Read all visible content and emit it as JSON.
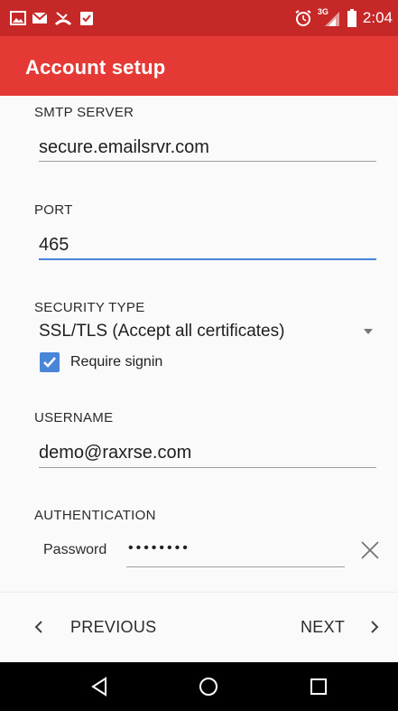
{
  "status_bar": {
    "time": "2:04",
    "network": "3G",
    "icons": [
      "image-icon",
      "mail-icon",
      "missed-call-icon",
      "clipboard-check-icon",
      "alarm-icon",
      "signal-icon",
      "battery-icon"
    ]
  },
  "app_bar": {
    "title": "Account setup"
  },
  "form": {
    "smtp_server": {
      "label": "SMTP SERVER",
      "value": "secure.emailsrvr.com"
    },
    "port": {
      "label": "PORT",
      "value": "465"
    },
    "security_type": {
      "label": "SECURITY TYPE",
      "value": "SSL/TLS (Accept all certificates)"
    },
    "require_signin": {
      "label": "Require signin",
      "checked": true
    },
    "username": {
      "label": "USERNAME",
      "value": "demo@raxrse.com"
    },
    "authentication": {
      "label": "AUTHENTICATION",
      "password_label": "Password",
      "password_value": "••••••••"
    }
  },
  "nav": {
    "previous_label": "PREVIOUS",
    "next_label": "NEXT"
  },
  "colors": {
    "status_bar": "#c62828",
    "app_bar": "#e53935",
    "accent": "#4a86d8"
  }
}
